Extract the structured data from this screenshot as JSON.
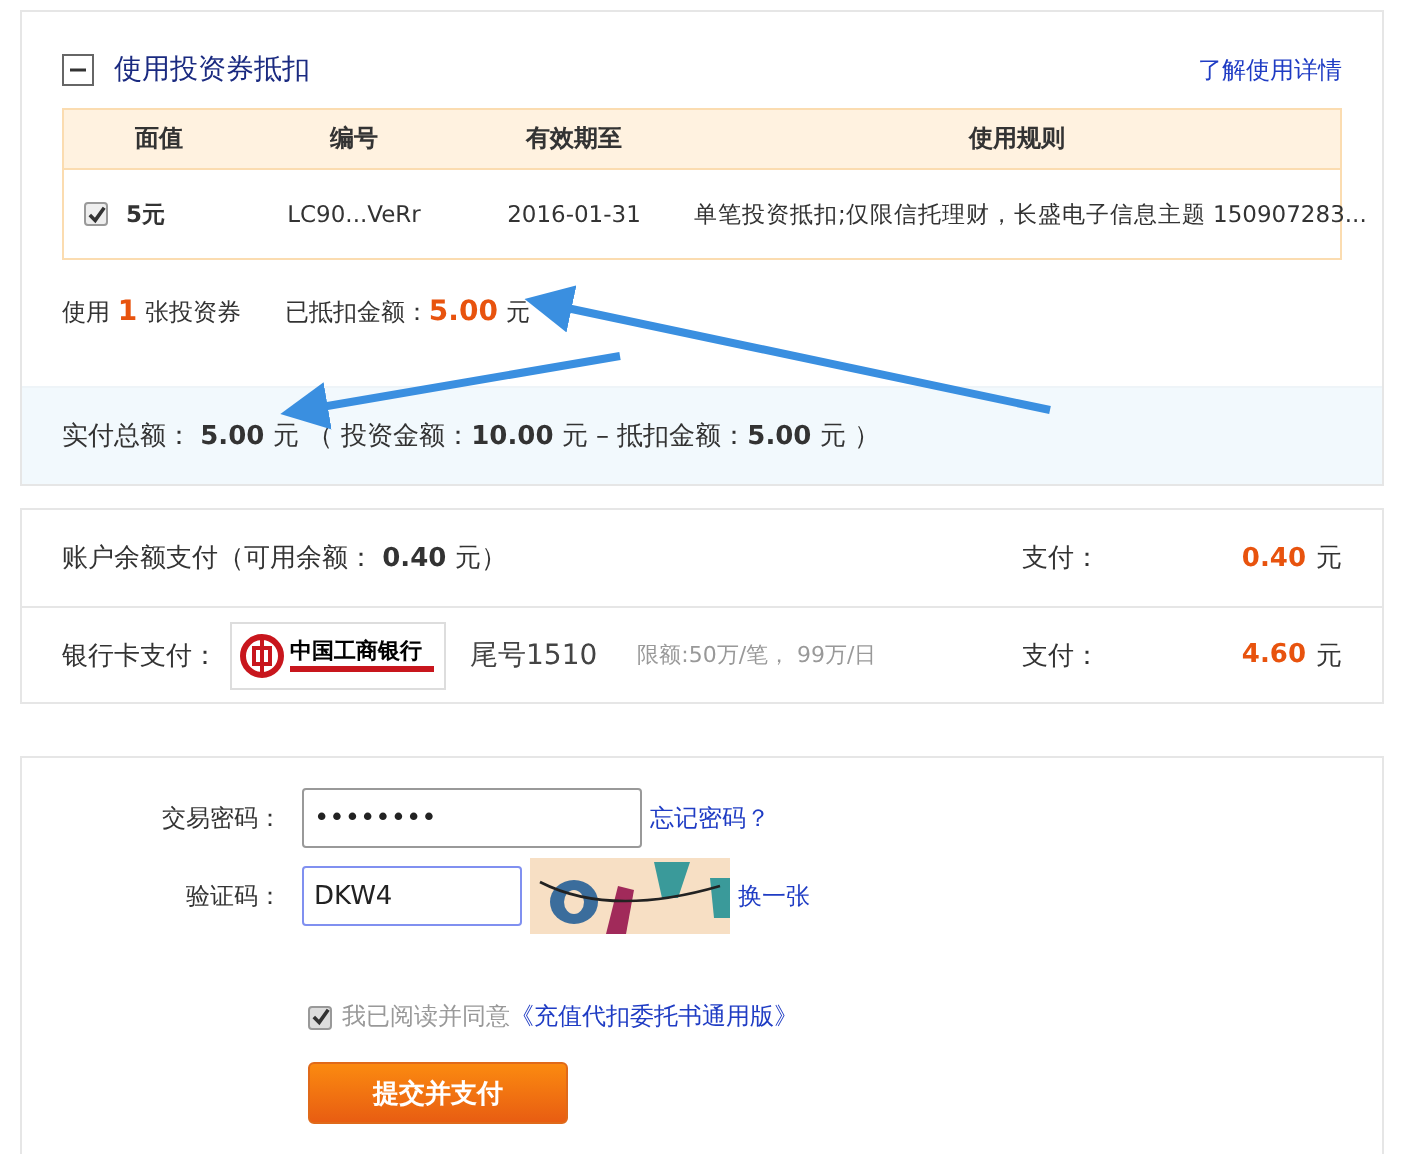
{
  "coupon": {
    "expanded": true,
    "title": "使用投资券抵扣",
    "help_link": "了解使用详情",
    "columns": [
      "面值",
      "编号",
      "有效期至",
      "使用规则"
    ],
    "rows": [
      {
        "checked": true,
        "value": "5元",
        "code": "LC90...VeRr",
        "expiry": "2016-01-31",
        "rule": "单笔投资抵扣;仅限信托理财，长盛电子信息主题 150907283..."
      }
    ],
    "count_text": "使用 **1** 张投资券",
    "deducted_text": "已抵扣金额：**5.00** 元"
  },
  "total": {
    "text": "实付总额： **5.00** 元 （ 投资金额：**10.00** 元 – 抵扣金额：**5.00** 元 ）"
  },
  "payments": [
    {
      "kind": "balance",
      "label": "账户余额支付（可用余额： **0.40** 元）",
      "pay_label": "支付：",
      "amount": "0.40",
      "unit": "元"
    },
    {
      "kind": "bank",
      "label": "银行卡支付：",
      "bank_name": "中国工商银行",
      "card": "尾号1510",
      "limit": "限额:50万/笔， 99万/日",
      "pay_label": "支付：",
      "amount": "4.60",
      "unit": "元"
    }
  ],
  "form": {
    "fields": [
      {
        "kind": "password",
        "label": "交易密码：",
        "value": "••••••••",
        "link": "忘记密码？",
        "focused": false
      },
      {
        "kind": "captcha",
        "label": "验证码：",
        "value": "DKW4",
        "link": "换一张",
        "focused": true
      }
    ],
    "agreement": {
      "checked": true,
      "text": "我已阅读并同意",
      "link": "《充值代扣委托书通用版》"
    },
    "submit": "提交并支付"
  }
}
